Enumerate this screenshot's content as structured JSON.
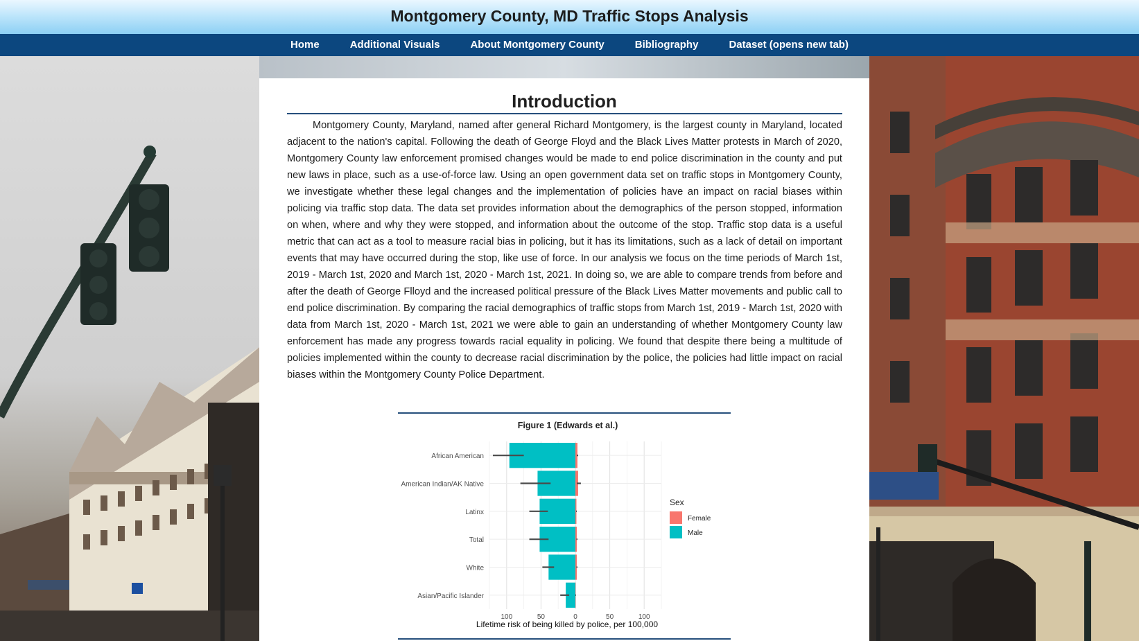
{
  "header": {
    "title": "Montgomery County, MD Traffic Stops Analysis"
  },
  "nav": {
    "items": [
      {
        "label": "Home"
      },
      {
        "label": "Additional Visuals"
      },
      {
        "label": "About Montgomery County"
      },
      {
        "label": "Bibliography"
      },
      {
        "label": "Dataset (opens new tab)"
      }
    ]
  },
  "main": {
    "section_title": "Introduction",
    "intro_paragraph": "Montgomery County, Maryland, named after general Richard Montgomery, is the largest county in Maryland, located adjacent to the nation's capital. Following the death of George Floyd and the Black Lives Matter protests in March of 2020, Montgomery County law enforcement promised changes would be made to end police discrimination in the county and put new laws in place, such as a use-of-force law. Using an open government data set on traffic stops in Montgomery County, we investigate whether these legal changes and the implementation of policies have an impact on racial biases within policing via traffic stop data. The data set provides information about the demographics of the person stopped, information on when, where and why they were stopped, and information about the outcome of the stop. Traffic stop data is a useful metric that can act as a tool to measure racial bias in policing, but it has its limitations, such as a lack of detail on important events that may have occurred during the stop, like use of force. In our analysis we focus on the time periods of March 1st, 2019 - March 1st, 2020 and March 1st, 2020 - March 1st, 2021. In doing so, we are able to compare trends from before and after the death of George Flloyd and the increased political pressure of the Black Lives Matter movements and public call to end police discrimination. By comparing the racial demographics of traffic stops from March 1st, 2019 - March 1st, 2020 with data from March 1st, 2020 - March 1st, 2021 we were able to gain an understanding of whether Montgomery County law enforcement has made any progress towards racial equality in policing. We found that despite there being a multitude of policies implemented within the county to decrease racial discrimination by the police, the policies had little impact on racial biases within the Montgomery County Police Department."
  },
  "colors": {
    "header_top": "#eaf7ff",
    "header_bottom": "#8dd0f4",
    "nav_bg": "#0c477f",
    "rule": "#264f7c",
    "male": "#00bfc4",
    "female": "#f8766d"
  },
  "chart_data": {
    "type": "bar",
    "title": "Figure 1 (Edwards et al.)",
    "xlabel": "Lifetime risk of being killed by police, per 100,000",
    "ylabel": "",
    "categories": [
      "African American",
      "American Indian/AK Native",
      "Latinx",
      "Total",
      "White",
      "Asian/Pacific Islander"
    ],
    "series": [
      {
        "name": "Male",
        "values": [
          96,
          55,
          52,
          52,
          39,
          14
        ],
        "error_low": [
          75,
          36,
          40,
          39,
          31,
          9
        ],
        "error_high": [
          120,
          80,
          67,
          67,
          48,
          22
        ]
      },
      {
        "name": "Female",
        "values": [
          3,
          4,
          1.5,
          2,
          2,
          0.5
        ],
        "error_low": [
          2,
          2,
          1,
          1.5,
          1.5,
          0.2
        ],
        "error_high": [
          4,
          8,
          2,
          3,
          3,
          1
        ]
      }
    ],
    "x_ticks": [
      "100",
      "50",
      "0",
      "50",
      "100"
    ],
    "x_tick_values": [
      -100,
      -50,
      0,
      50,
      100
    ],
    "xlim": [
      -125,
      125
    ],
    "legend": {
      "title": "Sex",
      "entries": [
        "Female",
        "Male"
      ],
      "position": "right"
    },
    "grid": true
  }
}
